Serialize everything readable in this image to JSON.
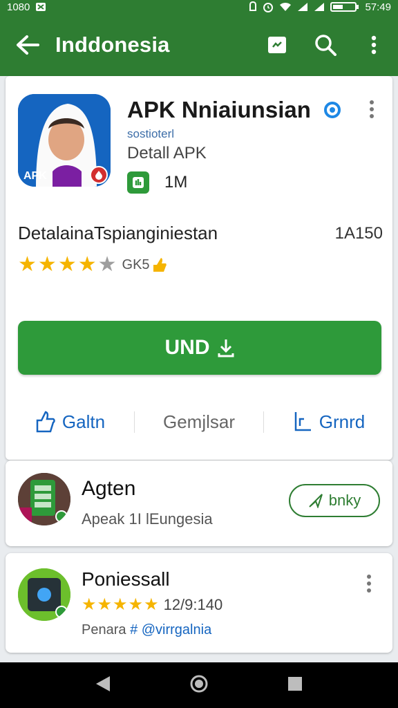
{
  "status_bar": {
    "time_left": "1080",
    "time_right": "57:49",
    "icons": [
      "notification-icon",
      "vpn-icon",
      "alarm-icon",
      "wifi-icon",
      "signal-icon",
      "battery-icon"
    ]
  },
  "app_bar": {
    "title": "Inddonesia",
    "background": "#2e7d32",
    "actions": [
      "store-icon",
      "search-icon",
      "more-vert-icon"
    ]
  },
  "app": {
    "name": "APK Nniaiunsian",
    "developer": "sostioterl",
    "detail": "Detall APK",
    "icon_text": "APK",
    "size": "1M",
    "description": "DetalainaTspianginiestan",
    "count": "1A150",
    "rating": 4,
    "rating_text": "GK5",
    "install_label": "UND",
    "accent": "#2e9a3a"
  },
  "actions": {
    "left": "Galtn",
    "middle": "Gemjlsar",
    "right": "Grnrd"
  },
  "cards": [
    {
      "title": "Agten",
      "subtitle": "Apeak 1I lEungesia",
      "button": "bnky"
    },
    {
      "title": "Poniessall",
      "stars": 5,
      "date": "12/9:140",
      "sub_prefix": "Penara",
      "sub_link": "# @virrgalnia"
    }
  ],
  "nav": [
    "back-icon",
    "home-icon",
    "recents-icon"
  ]
}
